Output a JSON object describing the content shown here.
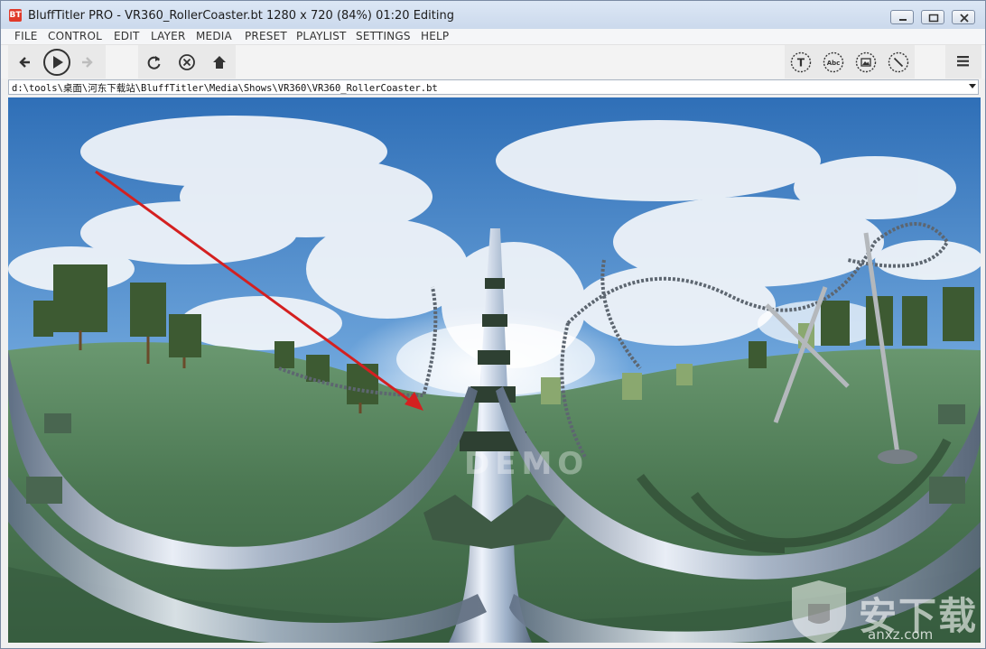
{
  "window": {
    "app_icon_text": "BT",
    "title": "BluffTitler PRO  - VR360_RollerCoaster.bt 1280 x 720 (84%) 01:20 Editing"
  },
  "menu": {
    "items": [
      "FILE",
      "CONTROL",
      "EDIT",
      "LAYER",
      "MEDIA",
      "PRESET",
      "PLAYLIST",
      "SETTINGS",
      "HELP"
    ]
  },
  "toolbar": {
    "left_icons": [
      "back-arrow-icon",
      "play-icon",
      "forward-arrow-icon"
    ],
    "middle_icons": [
      "refresh-icon",
      "stop-icon",
      "home-icon"
    ],
    "right_icons": [
      "text-layer-icon",
      "abc-layer-icon",
      "picture-layer-icon",
      "pen-layer-icon"
    ],
    "menu_icon": "hamburger-menu-icon",
    "text_layer_glyph": "T",
    "abc_layer_glyph": "Abc"
  },
  "path": {
    "value": "d:\\tools\\桌面\\河东下载站\\BluffTitler\\Media\\Shows\\VR360\\VR360_RollerCoaster.bt"
  },
  "viewport": {
    "watermark": "DEMO",
    "annotation": "red-arrow",
    "site_watermark_cn": "安下载",
    "site_watermark": "anxz.com"
  },
  "colors": {
    "title_bar": "#cbd9ec",
    "annotation_arrow": "#d42020",
    "sky": "#3f7fc4",
    "ground": "#4e7a55"
  }
}
